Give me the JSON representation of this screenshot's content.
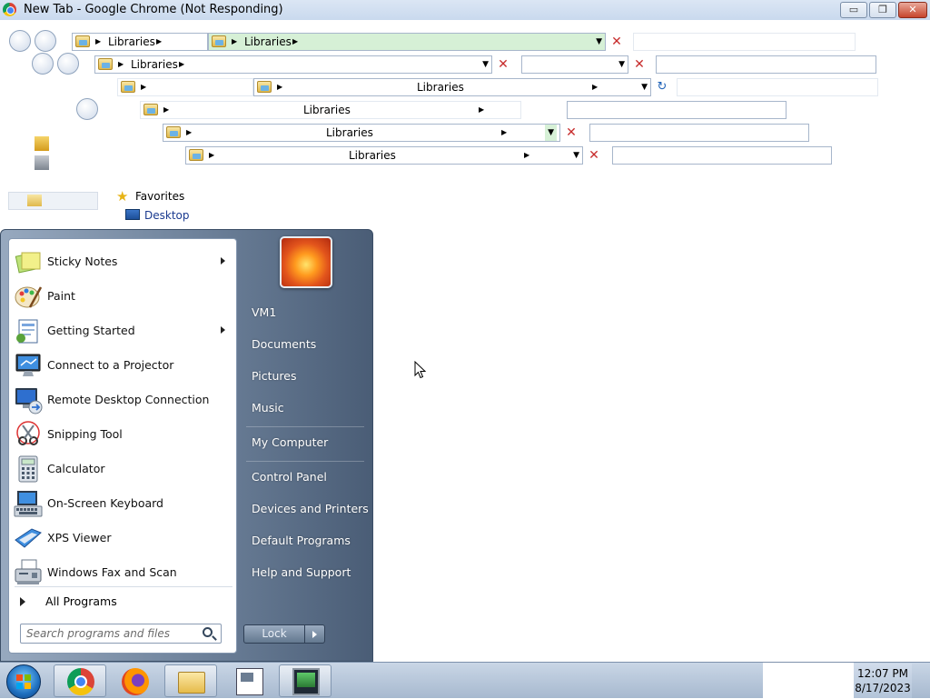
{
  "window": {
    "title": "New Tab - Google Chrome (Not Responding)",
    "minimize_glyph": "▭",
    "maximize_glyph": "❐",
    "close_glyph": "✕"
  },
  "explorer_ghost": {
    "breadcrumb_label": "Libraries",
    "favorites_label": "Favorites",
    "desktop_label": "Desktop",
    "close_glyph": "✕",
    "refresh_glyph": "↻",
    "dropdown_glyph": "▼",
    "chevron_glyph": "▶"
  },
  "start_menu": {
    "programs": [
      {
        "label": "Sticky Notes",
        "icon": "sticky-notes-icon",
        "has_submenu": true
      },
      {
        "label": "Paint",
        "icon": "paint-icon",
        "has_submenu": false
      },
      {
        "label": "Getting Started",
        "icon": "getting-started-icon",
        "has_submenu": true
      },
      {
        "label": "Connect to a Projector",
        "icon": "projector-icon",
        "has_submenu": false
      },
      {
        "label": "Remote Desktop Connection",
        "icon": "remote-desktop-icon",
        "has_submenu": false
      },
      {
        "label": "Snipping Tool",
        "icon": "scissors-icon",
        "has_submenu": false
      },
      {
        "label": "Calculator",
        "icon": "calculator-icon",
        "has_submenu": false
      },
      {
        "label": "On-Screen Keyboard",
        "icon": "keyboard-icon",
        "has_submenu": false
      },
      {
        "label": "XPS Viewer",
        "icon": "xps-viewer-icon",
        "has_submenu": false
      },
      {
        "label": "Windows Fax and Scan",
        "icon": "fax-scan-icon",
        "has_submenu": false
      }
    ],
    "all_programs": "All Programs",
    "search_placeholder": "Search programs and files",
    "right_items": {
      "user": "VM1",
      "documents": "Documents",
      "pictures": "Pictures",
      "music": "Music",
      "my_computer": "My Computer",
      "control_panel": "Control Panel",
      "devices_printers": "Devices and Printers",
      "default_programs": "Default Programs",
      "help_support": "Help and Support"
    },
    "lock_label": "Lock"
  },
  "taskbar": {
    "pinned": [
      "chrome-icon",
      "firefox-icon",
      "folder-icon",
      "document-icon",
      "monitor-icon"
    ],
    "clock_time": "12:07 PM",
    "clock_date": "8/17/2023"
  }
}
